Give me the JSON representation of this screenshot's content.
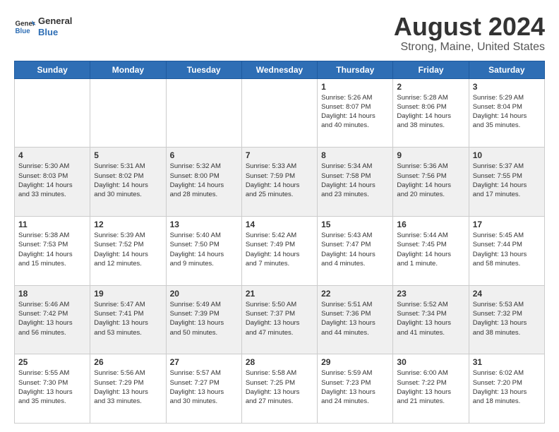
{
  "header": {
    "logo_line1": "General",
    "logo_line2": "Blue",
    "title": "August 2024",
    "subtitle": "Strong, Maine, United States"
  },
  "days_of_week": [
    "Sunday",
    "Monday",
    "Tuesday",
    "Wednesday",
    "Thursday",
    "Friday",
    "Saturday"
  ],
  "weeks": [
    [
      {
        "num": "",
        "info": ""
      },
      {
        "num": "",
        "info": ""
      },
      {
        "num": "",
        "info": ""
      },
      {
        "num": "",
        "info": ""
      },
      {
        "num": "1",
        "info": "Sunrise: 5:26 AM\nSunset: 8:07 PM\nDaylight: 14 hours\nand 40 minutes."
      },
      {
        "num": "2",
        "info": "Sunrise: 5:28 AM\nSunset: 8:06 PM\nDaylight: 14 hours\nand 38 minutes."
      },
      {
        "num": "3",
        "info": "Sunrise: 5:29 AM\nSunset: 8:04 PM\nDaylight: 14 hours\nand 35 minutes."
      }
    ],
    [
      {
        "num": "4",
        "info": "Sunrise: 5:30 AM\nSunset: 8:03 PM\nDaylight: 14 hours\nand 33 minutes."
      },
      {
        "num": "5",
        "info": "Sunrise: 5:31 AM\nSunset: 8:02 PM\nDaylight: 14 hours\nand 30 minutes."
      },
      {
        "num": "6",
        "info": "Sunrise: 5:32 AM\nSunset: 8:00 PM\nDaylight: 14 hours\nand 28 minutes."
      },
      {
        "num": "7",
        "info": "Sunrise: 5:33 AM\nSunset: 7:59 PM\nDaylight: 14 hours\nand 25 minutes."
      },
      {
        "num": "8",
        "info": "Sunrise: 5:34 AM\nSunset: 7:58 PM\nDaylight: 14 hours\nand 23 minutes."
      },
      {
        "num": "9",
        "info": "Sunrise: 5:36 AM\nSunset: 7:56 PM\nDaylight: 14 hours\nand 20 minutes."
      },
      {
        "num": "10",
        "info": "Sunrise: 5:37 AM\nSunset: 7:55 PM\nDaylight: 14 hours\nand 17 minutes."
      }
    ],
    [
      {
        "num": "11",
        "info": "Sunrise: 5:38 AM\nSunset: 7:53 PM\nDaylight: 14 hours\nand 15 minutes."
      },
      {
        "num": "12",
        "info": "Sunrise: 5:39 AM\nSunset: 7:52 PM\nDaylight: 14 hours\nand 12 minutes."
      },
      {
        "num": "13",
        "info": "Sunrise: 5:40 AM\nSunset: 7:50 PM\nDaylight: 14 hours\nand 9 minutes."
      },
      {
        "num": "14",
        "info": "Sunrise: 5:42 AM\nSunset: 7:49 PM\nDaylight: 14 hours\nand 7 minutes."
      },
      {
        "num": "15",
        "info": "Sunrise: 5:43 AM\nSunset: 7:47 PM\nDaylight: 14 hours\nand 4 minutes."
      },
      {
        "num": "16",
        "info": "Sunrise: 5:44 AM\nSunset: 7:45 PM\nDaylight: 14 hours\nand 1 minute."
      },
      {
        "num": "17",
        "info": "Sunrise: 5:45 AM\nSunset: 7:44 PM\nDaylight: 13 hours\nand 58 minutes."
      }
    ],
    [
      {
        "num": "18",
        "info": "Sunrise: 5:46 AM\nSunset: 7:42 PM\nDaylight: 13 hours\nand 56 minutes."
      },
      {
        "num": "19",
        "info": "Sunrise: 5:47 AM\nSunset: 7:41 PM\nDaylight: 13 hours\nand 53 minutes."
      },
      {
        "num": "20",
        "info": "Sunrise: 5:49 AM\nSunset: 7:39 PM\nDaylight: 13 hours\nand 50 minutes."
      },
      {
        "num": "21",
        "info": "Sunrise: 5:50 AM\nSunset: 7:37 PM\nDaylight: 13 hours\nand 47 minutes."
      },
      {
        "num": "22",
        "info": "Sunrise: 5:51 AM\nSunset: 7:36 PM\nDaylight: 13 hours\nand 44 minutes."
      },
      {
        "num": "23",
        "info": "Sunrise: 5:52 AM\nSunset: 7:34 PM\nDaylight: 13 hours\nand 41 minutes."
      },
      {
        "num": "24",
        "info": "Sunrise: 5:53 AM\nSunset: 7:32 PM\nDaylight: 13 hours\nand 38 minutes."
      }
    ],
    [
      {
        "num": "25",
        "info": "Sunrise: 5:55 AM\nSunset: 7:30 PM\nDaylight: 13 hours\nand 35 minutes."
      },
      {
        "num": "26",
        "info": "Sunrise: 5:56 AM\nSunset: 7:29 PM\nDaylight: 13 hours\nand 33 minutes."
      },
      {
        "num": "27",
        "info": "Sunrise: 5:57 AM\nSunset: 7:27 PM\nDaylight: 13 hours\nand 30 minutes."
      },
      {
        "num": "28",
        "info": "Sunrise: 5:58 AM\nSunset: 7:25 PM\nDaylight: 13 hours\nand 27 minutes."
      },
      {
        "num": "29",
        "info": "Sunrise: 5:59 AM\nSunset: 7:23 PM\nDaylight: 13 hours\nand 24 minutes."
      },
      {
        "num": "30",
        "info": "Sunrise: 6:00 AM\nSunset: 7:22 PM\nDaylight: 13 hours\nand 21 minutes."
      },
      {
        "num": "31",
        "info": "Sunrise: 6:02 AM\nSunset: 7:20 PM\nDaylight: 13 hours\nand 18 minutes."
      }
    ]
  ]
}
